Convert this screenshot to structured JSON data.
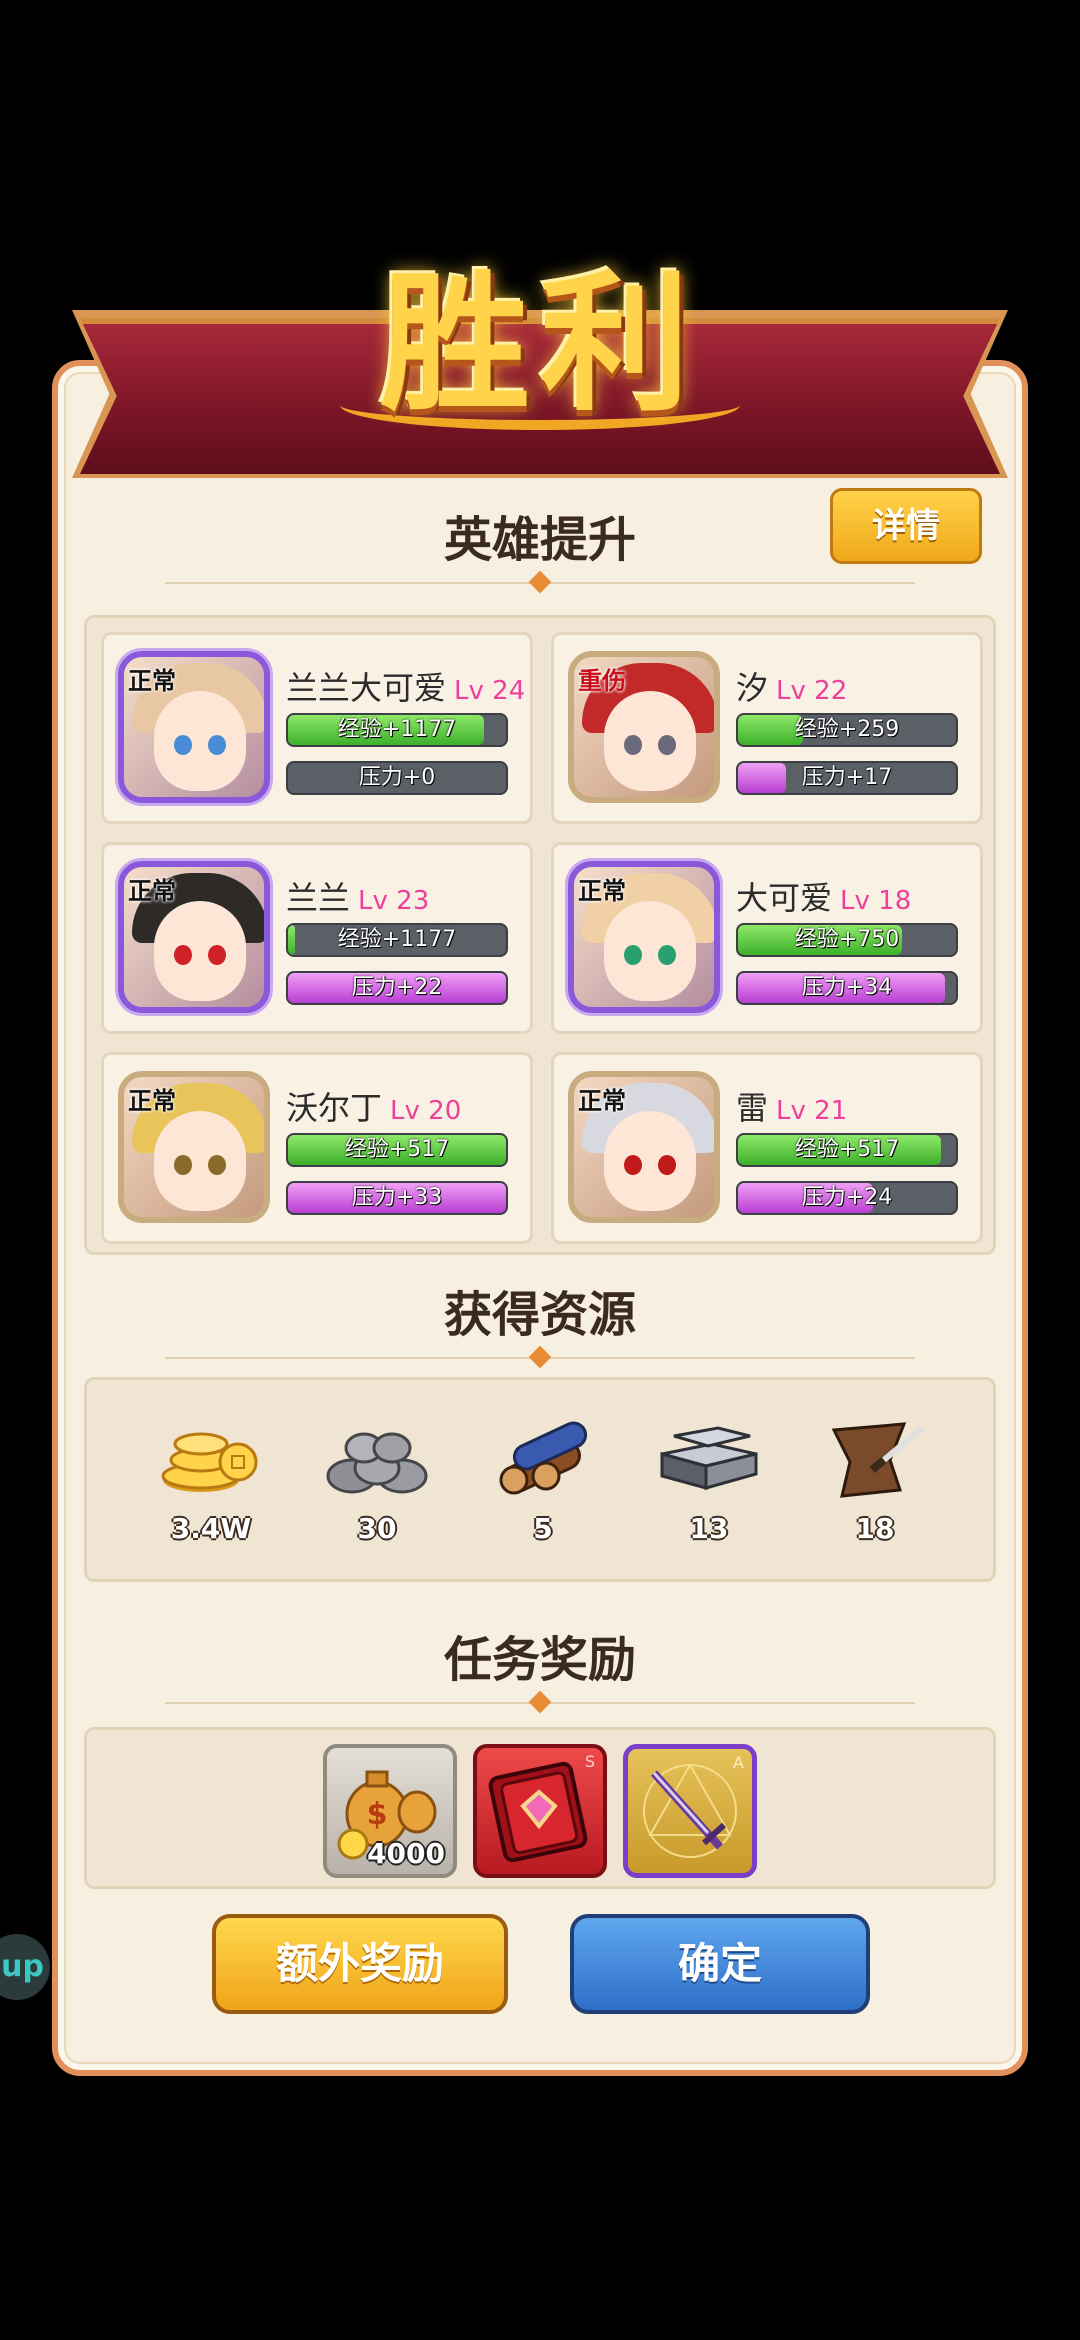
{
  "title": "胜利",
  "hero_section": {
    "title": "英雄提升",
    "detail_button": "详情",
    "heroes": [
      {
        "name": "兰兰大可爱",
        "level": "Lv 24",
        "status": "正常",
        "exp": "经验+1177",
        "stress": "压力+0",
        "exp_fill": 0.9,
        "stress_fill": 0.0,
        "rarity": "epic",
        "hair": "#e7c7a4",
        "eye": "#4a8bd6"
      },
      {
        "name": "汐",
        "level": "Lv 22",
        "status": "重伤",
        "exp": "经验+259",
        "stress": "压力+17",
        "exp_fill": 0.3,
        "stress_fill": 0.22,
        "rarity": "normal",
        "hair": "#c22a2a",
        "eye": "#6a6a7a"
      },
      {
        "name": "兰兰",
        "level": "Lv 23",
        "status": "正常",
        "exp": "经验+1177",
        "stress": "压力+22",
        "exp_fill": 0.03,
        "stress_fill": 1.0,
        "rarity": "epic",
        "hair": "#2e2a28",
        "eye": "#d02028"
      },
      {
        "name": "大可爱",
        "level": "Lv 18",
        "status": "正常",
        "exp": "经验+750",
        "stress": "压力+34",
        "exp_fill": 0.75,
        "stress_fill": 0.95,
        "rarity": "epic",
        "hair": "#f2d0a6",
        "eye": "#2aa070"
      },
      {
        "name": "沃尔丁",
        "level": "Lv 20",
        "status": "正常",
        "exp": "经验+517",
        "stress": "压力+33",
        "exp_fill": 1.0,
        "stress_fill": 1.0,
        "rarity": "normal",
        "hair": "#e8c45a",
        "eye": "#8a6a2a"
      },
      {
        "name": "雷",
        "level": "Lv 21",
        "status": "正常",
        "exp": "经验+517",
        "stress": "压力+24",
        "exp_fill": 0.93,
        "stress_fill": 0.62,
        "rarity": "normal",
        "hair": "#d8d8e0",
        "eye": "#c01a1a"
      }
    ]
  },
  "resource_section": {
    "title": "获得资源",
    "items": [
      {
        "icon": "gold-coins-icon",
        "value": "3.4W"
      },
      {
        "icon": "stone-pile-icon",
        "value": "30"
      },
      {
        "icon": "wood-logs-icon",
        "value": "5"
      },
      {
        "icon": "iron-ingots-icon",
        "value": "13"
      },
      {
        "icon": "leather-hide-icon",
        "value": "18"
      }
    ]
  },
  "task_section": {
    "title": "任务奖励",
    "rewards": [
      {
        "icon": "money-bag-icon",
        "value": "4000",
        "tier": "",
        "frame": "silver"
      },
      {
        "icon": "red-tome-icon",
        "value": "",
        "tier": "S",
        "frame": "red"
      },
      {
        "icon": "sword-icon",
        "value": "",
        "tier": "A",
        "frame": "gold-purple"
      }
    ]
  },
  "buttons": {
    "extra": "额外奖励",
    "confirm": "确定"
  },
  "side_bubble": "up"
}
